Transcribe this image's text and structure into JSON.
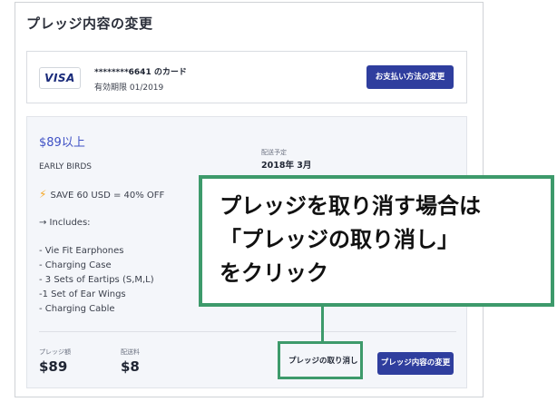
{
  "page": {
    "title": "プレッジ内容の変更"
  },
  "payment": {
    "brand": "VISA",
    "card_number": "********6641 のカード",
    "expiry": "有効期限 01/2019",
    "change_button": "お支払い方法の変更"
  },
  "reward": {
    "price": "$89以上",
    "name": "EARLY BIRDS",
    "saving": "SAVE 60 USD = 40% OFF",
    "includes": "→ Includes:",
    "items": [
      "- Vie Fit Earphones",
      "- Charging Case",
      "- 3 Sets of Eartips (S,M,L)",
      "-1 Set of Ear Wings",
      "- Charging Cable"
    ],
    "ship_label": "配送予定",
    "ship_date": "2018年 3月"
  },
  "summary": {
    "pledge_label": "プレッジ額",
    "pledge_value": "$89",
    "shipping_label": "配送料",
    "shipping_value": "$8",
    "cancel_label": "プレッジの取り消し",
    "edit_button": "プレッジ内容の変更"
  },
  "annotation": {
    "text": "プレッジを取り消す場合は\n「プレッジの取り消し」\nをクリック",
    "color": "#3d9a6b"
  }
}
